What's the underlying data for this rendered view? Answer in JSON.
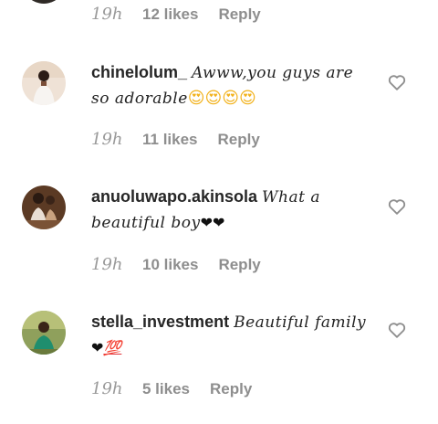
{
  "top_comment": {
    "time": "19h",
    "likes": "12 likes",
    "reply": "Reply"
  },
  "comments": [
    {
      "username": "chinelolum_",
      "text": "Awww,you guys are so adorable",
      "emoji": "😍😍😍😍",
      "time": "19h",
      "likes": "11 likes",
      "reply": "Reply"
    },
    {
      "username": "anuoluwapo.akinsola",
      "text": "What a beautiful boy",
      "emoji": "❤❤",
      "time": "19h",
      "likes": "10 likes",
      "reply": "Reply"
    },
    {
      "username": "stella_investment",
      "text": "Beautiful family",
      "emoji": "❤",
      "emoji2": "💯",
      "time": "19h",
      "likes": "5 likes",
      "reply": "Reply"
    }
  ],
  "icons": {
    "like": "heart-outline-icon"
  },
  "colors": {
    "text": "#262626",
    "muted": "#8e8e8e",
    "background": "#ffffff"
  }
}
